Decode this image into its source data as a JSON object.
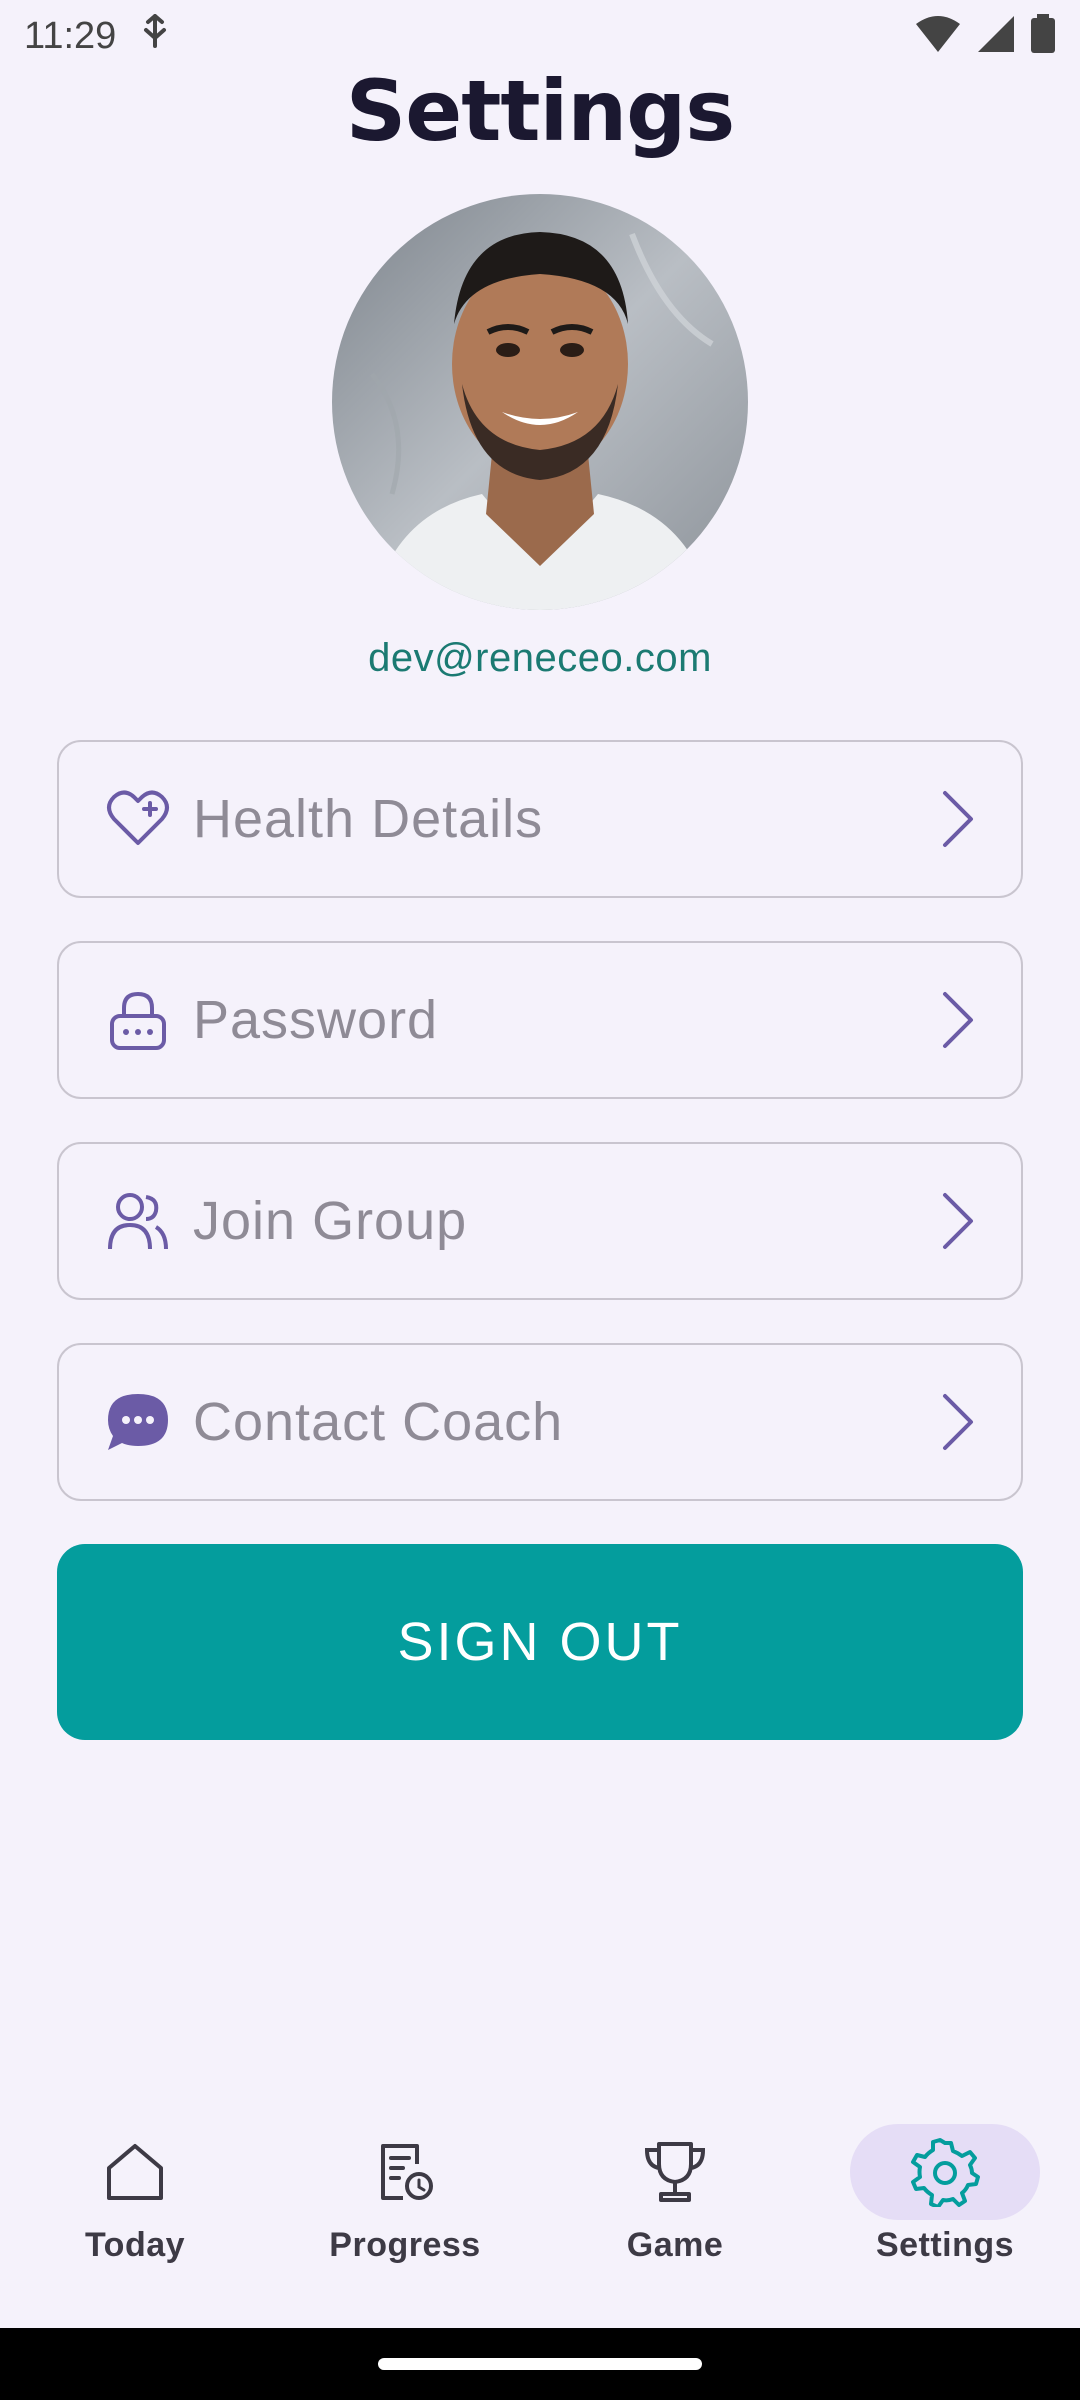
{
  "status_bar": {
    "time": "11:29",
    "icons": [
      "usb-debug-icon",
      "wifi-icon",
      "signal-icon",
      "battery-icon"
    ]
  },
  "header": {
    "title": "Settings"
  },
  "profile": {
    "email": "dev@reneceo.com",
    "avatar": "profile-photo"
  },
  "menu": [
    {
      "label": "Health Details",
      "icon": "heart-plus-icon"
    },
    {
      "label": "Password",
      "icon": "lock-icon"
    },
    {
      "label": "Join Group",
      "icon": "users-icon"
    },
    {
      "label": "Contact Coach",
      "icon": "chat-bubble-icon"
    }
  ],
  "sign_out": {
    "label": "SIGN OUT"
  },
  "bottom_nav": {
    "items": [
      {
        "label": "Today",
        "icon": "home-icon"
      },
      {
        "label": "Progress",
        "icon": "progress-report-icon"
      },
      {
        "label": "Game",
        "icon": "trophy-icon"
      },
      {
        "label": "Settings",
        "icon": "gear-icon"
      }
    ],
    "active": "Settings"
  },
  "colors": {
    "background": "#f5f2fb",
    "accent": "#049d9d",
    "icon_purple": "#6b5ba6",
    "email_green": "#1b7a72",
    "active_pill": "#e5ddf6"
  }
}
